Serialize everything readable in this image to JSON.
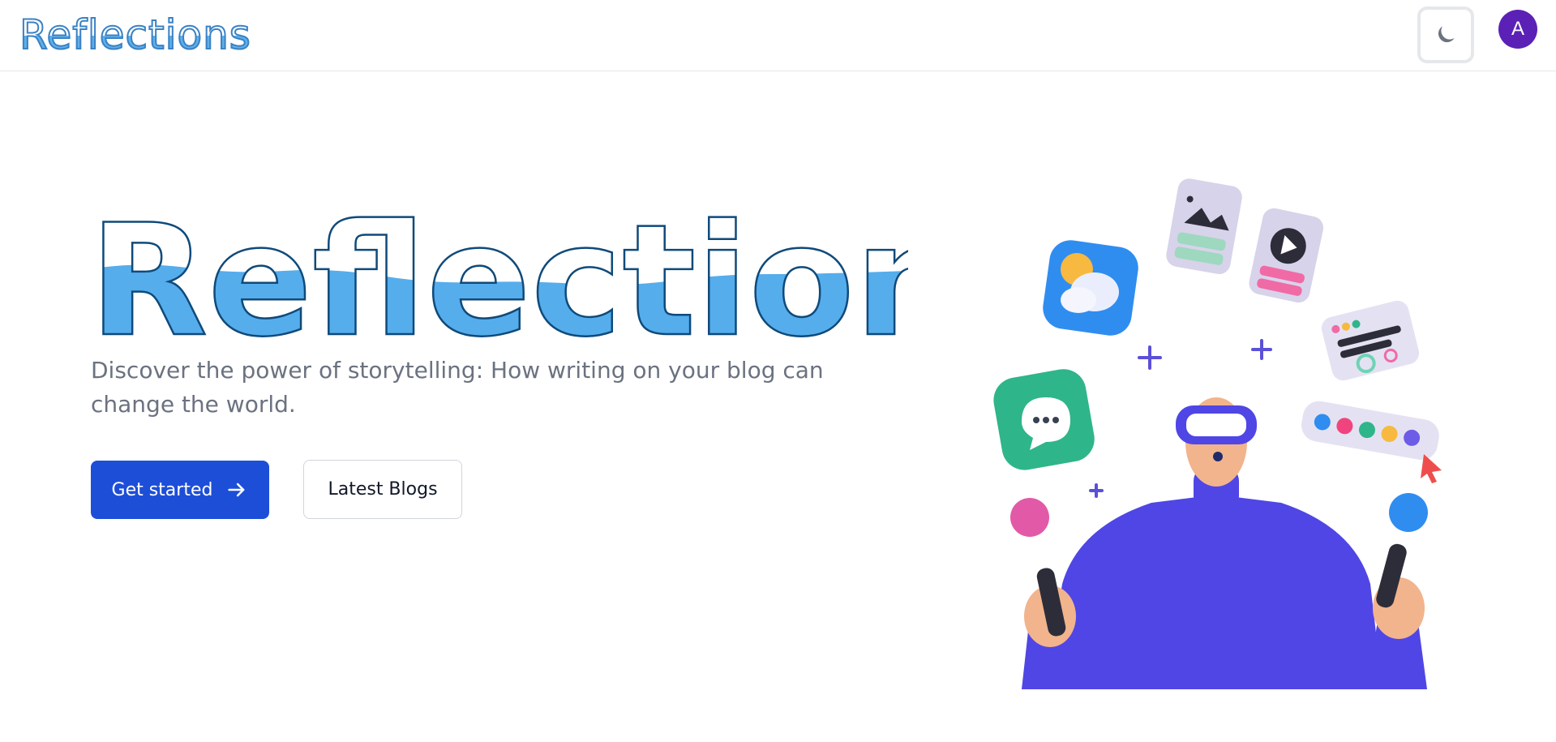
{
  "navbar": {
    "brand": "Reflections",
    "theme_toggle_icon": "moon-icon",
    "avatar_initial": "A"
  },
  "hero": {
    "title": "Reflections",
    "subtitle": "Discover the power of storytelling: How writing on your blog can change the world.",
    "primary_button": "Get started",
    "secondary_button": "Latest Blogs"
  },
  "colors": {
    "primary": "#1d4ed8",
    "title_fill": "#60b0ea",
    "title_stroke": "#0f4a7a",
    "avatar": "#5b21b6",
    "figure": "#4f46e5"
  }
}
